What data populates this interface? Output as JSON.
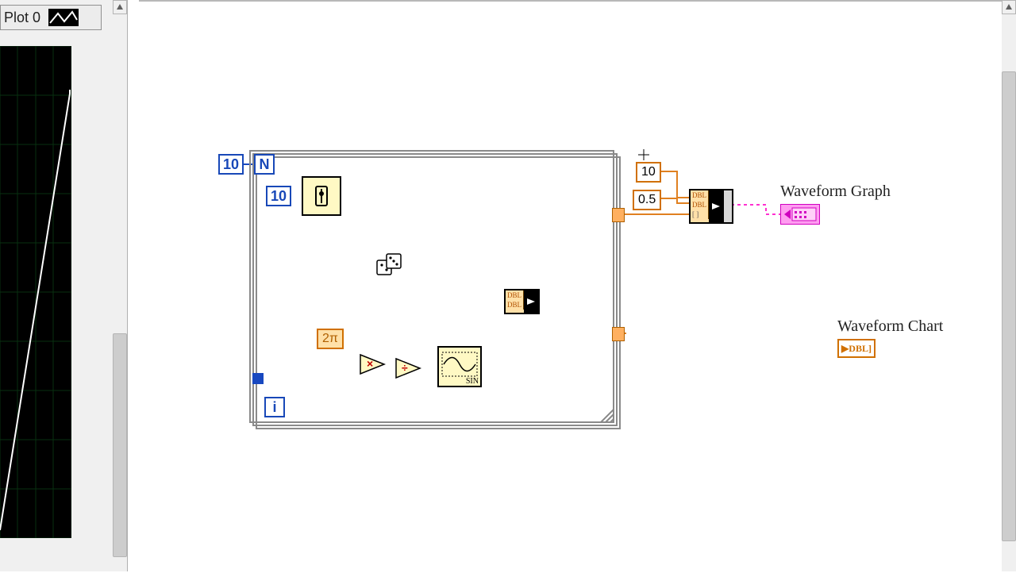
{
  "legend": {
    "label": "Plot 0"
  },
  "constants": {
    "loop_count": "10",
    "wait_ms": "10",
    "t0": "10",
    "dt": "0.5",
    "two_pi": "2π"
  },
  "loop": {
    "n_label": "N",
    "i_label": "i"
  },
  "nodes": {
    "sine_label": "SIN",
    "bundle_row": "DBL"
  },
  "indicators": {
    "graph_label": "Waveform Graph",
    "chart_label": "Waveform Chart",
    "chart_type": "▶DBL]"
  }
}
